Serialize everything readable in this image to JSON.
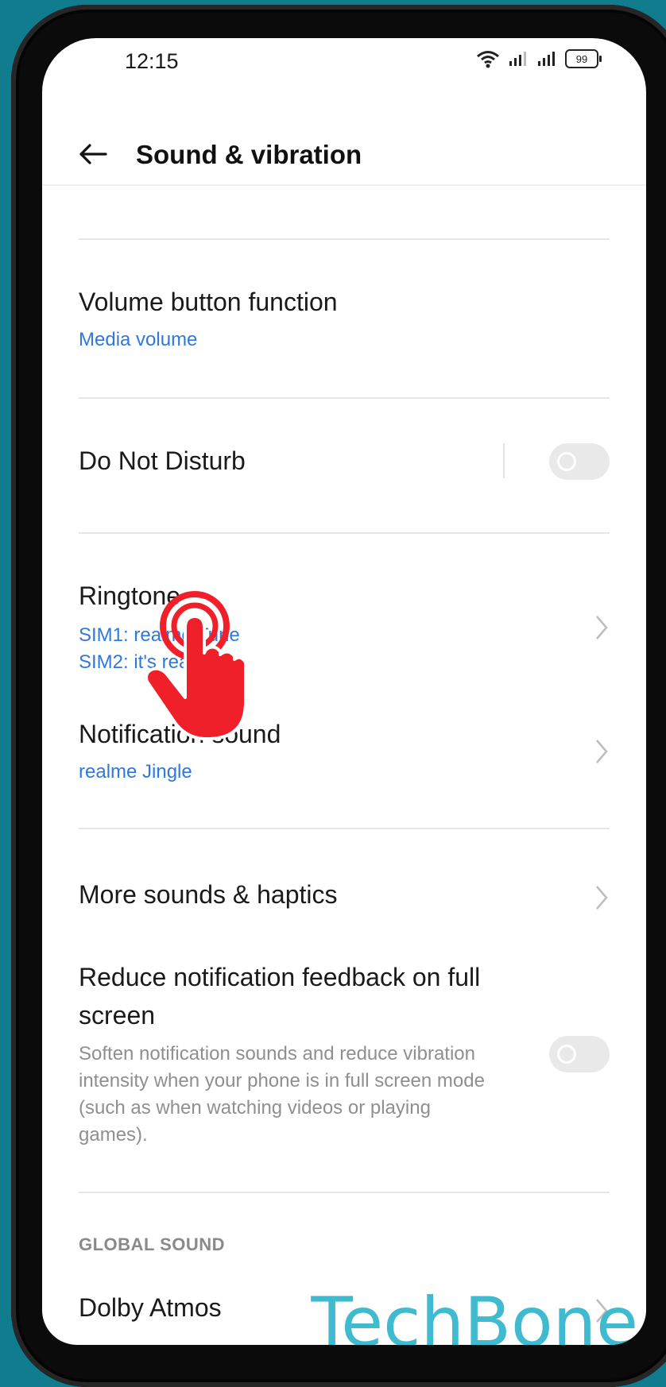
{
  "status_bar": {
    "time": "12:15",
    "battery": "99",
    "icons": [
      "wifi-icon",
      "signal-icon",
      "signal-icon",
      "battery-icon"
    ]
  },
  "app_bar": {
    "title": "Sound & vibration",
    "back_icon": "arrow-left-icon"
  },
  "settings": {
    "volume_button_function": {
      "title": "Volume button function",
      "value": "Media volume"
    },
    "do_not_disturb": {
      "title": "Do Not Disturb",
      "enabled": false
    },
    "ringtone": {
      "title": "Ringtone",
      "sim1": "SIM1: realme Tune",
      "sim2": "SIM2: it's realme"
    },
    "notification_sound": {
      "title": "Notification sound",
      "value": "realme Jingle"
    },
    "more_sounds": {
      "title": "More sounds & haptics"
    },
    "reduce_feedback": {
      "title_line1": "Reduce notification feedback on full",
      "title_line2": "screen",
      "description": "Soften notification sounds and reduce vibration intensity when your phone is in full screen mode (such as when watching videos or playing games).",
      "enabled": false
    },
    "global_sound_header": "GLOBAL SOUND",
    "dolby_atmos": {
      "title": "Dolby Atmos"
    }
  },
  "watermark": "TechBone",
  "colors": {
    "background": "#127c8f",
    "accent_link": "#2f78dd",
    "tap_indicator": "#f0202a",
    "watermark": "#2cb3c9"
  }
}
